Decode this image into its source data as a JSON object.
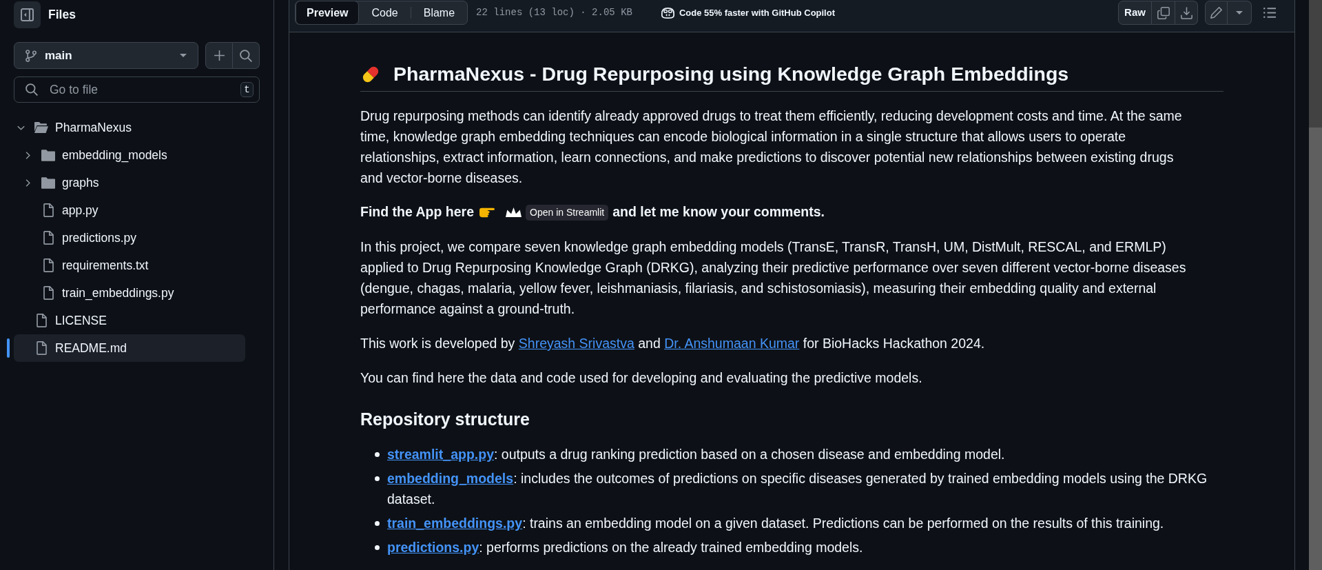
{
  "sidebar": {
    "title": "Files",
    "branch": "main",
    "search": {
      "placeholder": "Go to file",
      "shortcut": "t"
    },
    "tree": [
      {
        "kind": "folder",
        "name": "PharmaNexus",
        "expanded": true,
        "selected": false,
        "children": [
          {
            "kind": "folder",
            "name": "embedding_models",
            "expanded": false,
            "selected": false
          },
          {
            "kind": "folder",
            "name": "graphs",
            "expanded": false,
            "selected": false
          },
          {
            "kind": "file",
            "name": "app.py",
            "selected": false
          },
          {
            "kind": "file",
            "name": "predictions.py",
            "selected": false
          },
          {
            "kind": "file",
            "name": "requirements.txt",
            "selected": false
          },
          {
            "kind": "file",
            "name": "train_embeddings.py",
            "selected": false
          }
        ]
      },
      {
        "kind": "file",
        "name": "LICENSE",
        "selected": false
      },
      {
        "kind": "file",
        "name": "README.md",
        "selected": true
      }
    ]
  },
  "toolbar": {
    "tabs": [
      {
        "label": "Preview",
        "selected": true
      },
      {
        "label": "Code",
        "selected": false
      },
      {
        "label": "Blame",
        "selected": false
      }
    ],
    "file_info": "22 lines (13 loc) · 2.05 KB",
    "copilot_promo": "Code 55% faster with GitHub Copilot",
    "raw_button": "Raw"
  },
  "readme": {
    "title": "PharmaNexus - Drug Repurposing using Knowledge Graph Embeddings",
    "blocks": [
      {
        "kind": "paragraph",
        "segments": [
          {
            "kind": "text",
            "text": "Drug repurposing methods can identify already approved drugs to treat them efficiently, reducing development costs and time. At the same time, knowledge graph embedding techniques can encode biological information in a single structure that allows users to operate relationships, extract information, learn connections, and make predictions to discover potential new relationships between existing drugs and vector-borne diseases."
          }
        ]
      },
      {
        "kind": "app_line",
        "lead": "Find the App here",
        "badge": "Open in Streamlit",
        "tail": "and let me know your comments."
      },
      {
        "kind": "paragraph",
        "segments": [
          {
            "kind": "text",
            "text": "In this project, we compare seven knowledge graph embedding models (TransE, TransR, TransH, UM, DistMult, RESCAL, and ERMLP) applied to Drug Repurposing Knowledge Graph (DRKG), analyzing their predictive performance over seven different vector-borne diseases (dengue, chagas, malaria, yellow fever, leishmaniasis, filariasis, and schistosomiasis), measuring their embedding quality and external performance against a ground-truth."
          }
        ]
      },
      {
        "kind": "paragraph",
        "segments": [
          {
            "kind": "text",
            "text": "This work is developed by "
          },
          {
            "kind": "link",
            "text": "Shreyash Srivastva"
          },
          {
            "kind": "text",
            "text": " and "
          },
          {
            "kind": "link",
            "text": "Dr. Anshumaan Kumar"
          },
          {
            "kind": "text",
            "text": " for BioHacks Hackathon 2024."
          }
        ]
      },
      {
        "kind": "paragraph",
        "segments": [
          {
            "kind": "text",
            "text": "You can find here the data and code used for developing and evaluating the predictive models."
          }
        ]
      },
      {
        "kind": "heading",
        "text": "Repository structure"
      },
      {
        "kind": "list",
        "items": [
          {
            "link": "streamlit_app.py",
            "text": ": outputs a drug ranking prediction based on a chosen disease and embedding model."
          },
          {
            "link": "embedding_models",
            "text": ": includes the outcomes of predictions on specific diseases generated by trained embedding models using the DRKG dataset."
          },
          {
            "link": "train_embeddings.py",
            "text": ": trains an embedding model on a given dataset. Predictions can be performed on the results of this training."
          },
          {
            "link": "predictions.py",
            "text": ": performs predictions on the already trained embedding models."
          }
        ]
      }
    ]
  }
}
